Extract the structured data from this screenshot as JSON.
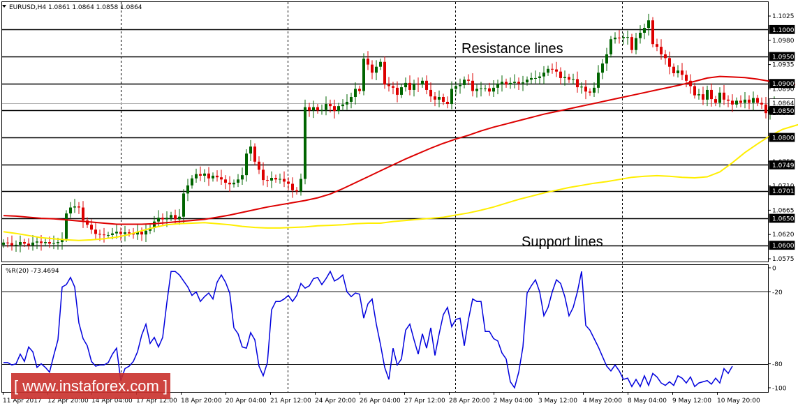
{
  "header": {
    "symbol_line": "EURUSD,H4  1.0861 1.0864 1.0858 1.0864"
  },
  "chart_data": [
    {
      "type": "candlestick",
      "name": "EURUSD,H4",
      "ohlc_text": "1.0861 1.0864 1.0858 1.0864",
      "last_price": "1.0864",
      "ylim": [
        1.0566,
        1.1048
      ],
      "y_ticks": [
        "1.1025",
        "1.0980",
        "1.0935",
        "1.0890",
        "1.0845",
        "1.0800",
        "1.0755",
        "1.0710",
        "1.0665",
        "1.0620",
        "1.0575"
      ],
      "close": [
        1.0605,
        1.0604,
        1.06,
        1.0601,
        1.0606,
        1.0603,
        1.06,
        1.0605,
        1.0607,
        1.0604,
        1.0606,
        1.0603,
        1.0604,
        1.0606,
        1.0612,
        1.0659,
        1.067,
        1.0672,
        1.067,
        1.0646,
        1.0638,
        1.0629,
        1.0621,
        1.062,
        1.0619,
        1.0619,
        1.0622,
        1.0625,
        1.0621,
        1.0624,
        1.0622,
        1.062,
        1.0625,
        1.062,
        1.0627,
        1.0632,
        1.0644,
        1.0651,
        1.0648,
        1.0651,
        1.0656,
        1.0648,
        1.0653,
        1.0696,
        1.0711,
        1.0724,
        1.0732,
        1.0729,
        1.0733,
        1.0724,
        1.0729,
        1.0726,
        1.0722,
        1.0716,
        1.0713,
        1.0716,
        1.0722,
        1.073,
        1.077,
        1.0783,
        1.0755,
        1.074,
        1.0721,
        1.072,
        1.0725,
        1.0722,
        1.0723,
        1.0718,
        1.0714,
        1.0702,
        1.07,
        1.0723,
        1.0856,
        1.085,
        1.0856,
        1.085,
        1.0851,
        1.0862,
        1.0858,
        1.0849,
        1.0858,
        1.0861,
        1.0866,
        1.0875,
        1.089,
        1.0886,
        1.0946,
        1.0935,
        1.092,
        1.0931,
        1.094,
        1.0898,
        1.0895,
        1.0892,
        1.0879,
        1.0893,
        1.0901,
        1.0888,
        1.0899,
        1.0898,
        1.0905,
        1.0888,
        1.0876,
        1.087,
        1.0875,
        1.0866,
        1.0862,
        1.089,
        1.0895,
        1.0897,
        1.0907,
        1.0905,
        1.0886,
        1.089,
        1.0891,
        1.0891,
        1.0885,
        1.0892,
        1.0899,
        1.0903,
        1.0898,
        1.0901,
        1.0903,
        1.09,
        1.0902,
        1.0907,
        1.091,
        1.091,
        1.0913,
        1.092,
        1.0927,
        1.0926,
        1.0922,
        1.091,
        1.0912,
        1.0907,
        1.0908,
        1.0893,
        1.0894,
        1.0885,
        1.0883,
        1.0892,
        1.092,
        1.0937,
        1.0954,
        1.0982,
        1.0985,
        1.0984,
        1.0986,
        1.0986,
        1.0962,
        1.0984,
        1.0994,
        1.1003,
        1.1017,
        1.0973,
        1.0968,
        1.0954,
        1.0947,
        1.0931,
        1.0919,
        1.0924,
        1.0916,
        1.0905,
        1.0895,
        1.0878,
        1.088,
        1.087,
        1.0888,
        1.0871,
        1.0864,
        1.0883,
        1.087,
        1.0868,
        1.0861,
        1.0868,
        1.0864,
        1.087,
        1.0864,
        1.0873,
        1.0864,
        1.0861,
        1.0845,
        1.0856,
        1.0864
      ],
      "ma_fast": [
        1.0625,
        1.0622,
        1.0618,
        1.0614,
        1.0612,
        1.061,
        1.0609,
        1.061,
        1.0612,
        1.0615,
        1.062,
        1.0627,
        1.0633,
        1.0638,
        1.064,
        1.0641,
        1.0642,
        1.064,
        1.0638,
        1.0635,
        1.0633,
        1.0632,
        1.0632,
        1.0633,
        1.0634,
        1.0636,
        1.0637,
        1.0638,
        1.064,
        1.0641,
        1.0641,
        1.0644,
        1.0646,
        1.0648,
        1.065,
        1.0652,
        1.0656,
        1.066,
        1.0665,
        1.0671,
        1.0678,
        1.0685,
        1.0691,
        1.0697,
        1.0702,
        1.0707,
        1.0711,
        1.0715,
        1.0718,
        1.0722,
        1.0726,
        1.0728,
        1.0729,
        1.0728,
        1.0726,
        1.0725,
        1.0727,
        1.0736,
        1.0753,
        1.0772,
        1.0788,
        1.0803,
        1.0815,
        1.0822,
        1.0829,
        1.0835,
        1.084,
        1.0847,
        1.0854,
        1.086,
        1.0864,
        1.0875,
        1.0885,
        1.0894,
        1.0899,
        1.0901,
        1.0902,
        1.09,
        1.0899,
        1.0898,
        1.0899,
        1.0897,
        1.0895,
        1.0893,
        1.0891,
        1.089,
        1.089,
        1.0891,
        1.0892,
        1.0892,
        1.0895,
        1.0895,
        1.0894,
        1.0894,
        1.0892,
        1.0892,
        1.0893,
        1.0894,
        1.0896,
        1.0899,
        1.0901,
        1.0904,
        1.0907,
        1.0909,
        1.091,
        1.0912,
        1.0915,
        1.0918,
        1.0922,
        1.0925,
        1.0927,
        1.093,
        1.0933,
        1.0937,
        1.0944,
        1.0952,
        1.0961,
        1.0967,
        1.097,
        1.0973,
        1.0972,
        1.097,
        1.0968,
        1.0961,
        1.0952,
        1.0942,
        1.0933,
        1.0924,
        1.0915,
        1.0906,
        1.0897,
        1.0887,
        1.0883,
        1.088,
        1.0876,
        1.0873,
        1.0871,
        1.0869,
        1.0868,
        1.0866
      ],
      "ma_slow": [
        1.0655,
        1.0654,
        1.0652,
        1.065,
        1.0649,
        1.0647,
        1.0645,
        1.0643,
        1.0641,
        1.0639,
        1.0639,
        1.0639,
        1.064,
        1.0642,
        1.0644,
        1.0646,
        1.0648,
        1.0652,
        1.0656,
        1.0661,
        1.0666,
        1.0671,
        1.0675,
        1.0679,
        1.0683,
        1.0688,
        1.0695,
        1.0705,
        1.0716,
        1.0727,
        1.0738,
        1.0749,
        1.076,
        1.077,
        1.078,
        1.0789,
        1.0797,
        1.0804,
        1.0812,
        1.0819,
        1.0825,
        1.0831,
        1.0837,
        1.0843,
        1.0848,
        1.0853,
        1.0858,
        1.0863,
        1.0868,
        1.0873,
        1.0878,
        1.0883,
        1.0888,
        1.0893,
        1.0898,
        1.0904,
        1.091,
        1.0913,
        1.0912,
        1.0911,
        1.0908,
        1.0904,
        1.0901,
        1.0898
      ],
      "resistance_levels": [
        1.1,
        1.095,
        1.09,
        1.085
      ],
      "support_levels": [
        1.08,
        1.0749,
        1.0701,
        1.065,
        1.06
      ],
      "price_labels": [
        "1.1000",
        "1.0950",
        "1.0900",
        "1.0864",
        "1.0850",
        "1.0800",
        "1.0749",
        "1.0701",
        "1.0650",
        "1.0600"
      ],
      "annotations": [
        "Resistance lines",
        "Support lines"
      ],
      "grid": "dashed vertical date dividers",
      "colors": {
        "up": "#006400",
        "down": "#dd0000",
        "ma_fast": "#ffee00",
        "ma_slow": "#dd0000",
        "level": "#000000"
      }
    },
    {
      "type": "line",
      "name": "%R(20)",
      "label": "%R(20) -73.4694",
      "ylim": [
        -100,
        0
      ],
      "y_ticks": [
        "0",
        "-20",
        "-80",
        "-100"
      ],
      "levels": [
        -20,
        -80
      ],
      "values": [
        -79,
        -79,
        -81,
        -80,
        -72,
        -78,
        -66,
        -70,
        -83,
        -80,
        -83,
        -87,
        -73,
        -60,
        -16,
        -14,
        -8,
        -16,
        -46,
        -59,
        -65,
        -78,
        -82,
        -81,
        -81,
        -79,
        -72,
        -67,
        -94,
        -84,
        -82,
        -78,
        -70,
        -56,
        -47,
        -63,
        -58,
        -66,
        -58,
        -29,
        -3,
        -3,
        -6,
        -11,
        -16,
        -23,
        -20,
        -28,
        -24,
        -21,
        -26,
        -12,
        -6,
        -12,
        -21,
        -50,
        -55,
        -66,
        -67,
        -54,
        -60,
        -82,
        -90,
        -79,
        -35,
        -28,
        -28,
        -26,
        -23,
        -28,
        -23,
        -13,
        -17,
        -15,
        -9,
        -8,
        -14,
        -9,
        -3,
        -11,
        -9,
        -6,
        -20,
        -24,
        -21,
        -22,
        -42,
        -30,
        -26,
        -47,
        -64,
        -83,
        -93,
        -67,
        -81,
        -76,
        -52,
        -47,
        -60,
        -72,
        -55,
        -67,
        -50,
        -73,
        -55,
        -39,
        -33,
        -49,
        -43,
        -42,
        -65,
        -43,
        -26,
        -28,
        -28,
        -53,
        -53,
        -59,
        -61,
        -71,
        -76,
        -95,
        -100,
        -87,
        -66,
        -21,
        -15,
        -10,
        -20,
        -40,
        -33,
        -20,
        -10,
        -13,
        -24,
        -40,
        -33,
        -20,
        -3,
        -48,
        -52,
        -59,
        -66,
        -74,
        -82,
        -86,
        -81,
        -86,
        -93,
        -92,
        -99,
        -93,
        -99,
        -90,
        -98,
        -88,
        -91,
        -96,
        -98,
        -95,
        -98,
        -90,
        -92,
        -96,
        -91,
        -99,
        -96,
        -95,
        -94,
        -97,
        -92,
        -96,
        -84,
        -88,
        -82
      ]
    }
  ],
  "x_axis": {
    "labels": [
      "11 Apr 2017",
      "12 Apr 20:00",
      "14 Apr 04:00",
      "17 Apr 12:00",
      "18 Apr 20:00",
      "20 Apr 04:00",
      "21 Apr 12:00",
      "24 Apr 20:00",
      "26 Apr 04:00",
      "27 Apr 12:00",
      "28 Apr 20:00",
      "2 May 04:00",
      "3 May 12:00",
      "4 May 20:00",
      "8 May 04:00",
      "9 May 12:00",
      "10 May 20:00"
    ]
  },
  "watermark": {
    "text": "[ www.instaforex.com ]"
  },
  "icons": {
    "dropdown": "triangle-down-icon"
  }
}
